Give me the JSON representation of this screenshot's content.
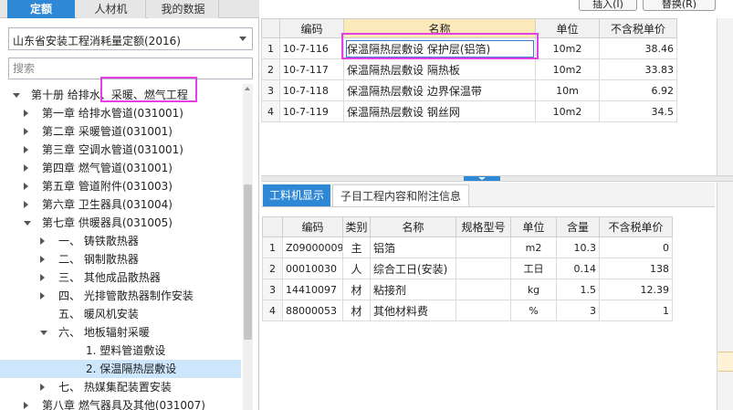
{
  "left_tabs": [
    "定额",
    "人材机",
    "我的数据"
  ],
  "library_select": {
    "value": "山东省安装工程消耗量定额(2016)"
  },
  "search": {
    "placeholder": "搜索"
  },
  "tree": [
    {
      "label": "第十册 给排水、采暖、燃气工程",
      "level": 0,
      "expander": "down"
    },
    {
      "label": "第一章 给排水管道(031001)",
      "level": 1,
      "expander": "right"
    },
    {
      "label": "第二章 采暖管道(031001)",
      "level": 1,
      "expander": "right"
    },
    {
      "label": "第三章 空调水管道(031001)",
      "level": 1,
      "expander": "right"
    },
    {
      "label": "第四章 燃气管道(031001)",
      "level": 1,
      "expander": "right"
    },
    {
      "label": "第五章 管道附件(031003)",
      "level": 1,
      "expander": "right"
    },
    {
      "label": "第六章 卫生器具(031004)",
      "level": 1,
      "expander": "right"
    },
    {
      "label": "第七章 供暖器具(031005)",
      "level": 1,
      "expander": "down"
    },
    {
      "label": "一、 铸铁散热器",
      "level": 2,
      "expander": "right"
    },
    {
      "label": "二、 钢制散热器",
      "level": 2,
      "expander": "right"
    },
    {
      "label": "三、 其他成品散热器",
      "level": 2,
      "expander": "right"
    },
    {
      "label": "四、 光排管散热器制作安装",
      "level": 2,
      "expander": "right"
    },
    {
      "label": "五、 暖风机安装",
      "level": 2,
      "expander": "none"
    },
    {
      "label": "六、 地板辐射采暖",
      "level": 2,
      "expander": "down"
    },
    {
      "label": "1. 塑料管道敷设",
      "level": 3,
      "expander": "none"
    },
    {
      "label": "2. 保温隔热层敷设",
      "level": 3,
      "expander": "none",
      "selected": true
    },
    {
      "label": "七、 热媒集配装置安装",
      "level": 2,
      "expander": "right"
    },
    {
      "label": "第八章 燃气器具及其他(031007)",
      "level": 1,
      "expander": "right"
    }
  ],
  "toolbar": {
    "insert_label": "插入(I)",
    "replace_label": "替换(R)"
  },
  "quota_table": {
    "headers": [
      "",
      "编码",
      "名称",
      "单位",
      "不含税单价"
    ],
    "rows": [
      {
        "no": "1",
        "code": "10-7-116",
        "name": "保温隔热层敷设 保护层(铝箔)",
        "unit": "10m2",
        "price": "38.46"
      },
      {
        "no": "2",
        "code": "10-7-117",
        "name": "保温隔热层敷设 隔热板",
        "unit": "10m2",
        "price": "33.83"
      },
      {
        "no": "3",
        "code": "10-7-118",
        "name": "保温隔热层敷设 边界保温带",
        "unit": "10m",
        "price": "6.92"
      },
      {
        "no": "4",
        "code": "10-7-119",
        "name": "保温隔热层敷设 钢丝网",
        "unit": "10m2",
        "price": "34.5"
      }
    ]
  },
  "bottom_tabs": [
    "工料机显示",
    "子目工程内容和附注信息"
  ],
  "resource_table": {
    "headers": [
      "",
      "编码",
      "类别",
      "名称",
      "规格型号",
      "单位",
      "含量",
      "不含税单价"
    ],
    "rows": [
      {
        "no": "1",
        "code": "Z09000009",
        "cat": "主",
        "name": "铝箔",
        "spec": "",
        "unit": "m2",
        "qty": "10.3",
        "price": "0"
      },
      {
        "no": "2",
        "code": "00010030",
        "cat": "人",
        "name": "综合工日(安装)",
        "spec": "",
        "unit": "工日",
        "qty": "0.14",
        "price": "138"
      },
      {
        "no": "3",
        "code": "14410097",
        "cat": "材",
        "name": "粘接剂",
        "spec": "",
        "unit": "kg",
        "qty": "1.5",
        "price": "12.39"
      },
      {
        "no": "4",
        "code": "88000053",
        "cat": "材",
        "name": "其他材料费",
        "spec": "",
        "unit": "%",
        "qty": "3",
        "price": "1"
      }
    ]
  },
  "colors": {
    "accent": "#2f88d6",
    "highlight_box": "#e43fe2",
    "selected_row": "#cde6fb",
    "name_header": "#fbe9ba"
  }
}
